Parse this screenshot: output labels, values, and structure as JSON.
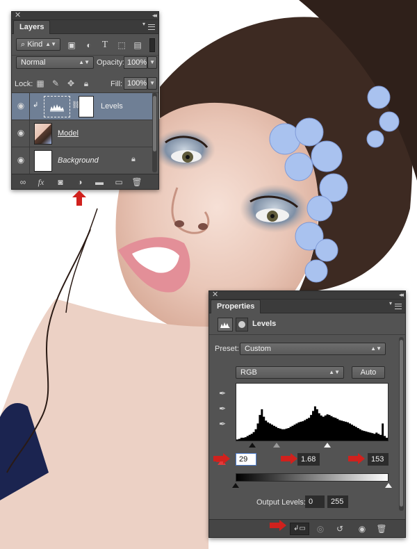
{
  "layers_panel": {
    "tab": "Layers",
    "filter_kind": "Kind",
    "blend_mode": "Normal",
    "opacity_label": "Opacity:",
    "opacity_value": "100%",
    "lock_label": "Lock:",
    "fill_label": "Fill:",
    "fill_value": "100%",
    "layers": [
      {
        "name": "Levels",
        "type": "adjustment",
        "active": true
      },
      {
        "name": "Model",
        "type": "image",
        "active": false
      },
      {
        "name": "Background",
        "type": "background",
        "active": false,
        "locked": true
      }
    ],
    "bottom_icons": [
      "link-icon",
      "fx-icon",
      "mask-icon",
      "adjustment-icon",
      "folder-icon",
      "new-layer-icon",
      "trash-icon"
    ]
  },
  "properties_panel": {
    "tab": "Properties",
    "adjustment_name": "Levels",
    "preset_label": "Preset:",
    "preset_value": "Custom",
    "channel_value": "RGB",
    "auto_label": "Auto",
    "input_black": "29",
    "input_gamma": "1.68",
    "input_white": "153",
    "output_label": "Output Levels:",
    "output_black": "0",
    "output_white": "255",
    "histogram_peaks": [
      0.02,
      0.03,
      0.05,
      0.05,
      0.06,
      0.08,
      0.1,
      0.12,
      0.15,
      0.2,
      0.3,
      0.45,
      0.55,
      0.42,
      0.35,
      0.32,
      0.3,
      0.28,
      0.26,
      0.24,
      0.22,
      0.21,
      0.2,
      0.2,
      0.21,
      0.22,
      0.24,
      0.26,
      0.28,
      0.3,
      0.32,
      0.33,
      0.34,
      0.36,
      0.38,
      0.4,
      0.45,
      0.52,
      0.6,
      0.55,
      0.48,
      0.44,
      0.42,
      0.44,
      0.46,
      0.45,
      0.43,
      0.41,
      0.4,
      0.38,
      0.36,
      0.35,
      0.34,
      0.33,
      0.32,
      0.3,
      0.28,
      0.26,
      0.24,
      0.22,
      0.2,
      0.18,
      0.17,
      0.16,
      0.15,
      0.14,
      0.13,
      0.12,
      0.14,
      0.12,
      0.1,
      0.3,
      0.08,
      0.05
    ],
    "bottom_icons": [
      "clip-to-layer-icon",
      "view-previous-icon",
      "reset-icon",
      "visibility-icon",
      "trash-icon"
    ]
  },
  "colors": {
    "panel_bg": "#535353",
    "panel_dark": "#3b3b3b",
    "active_layer": "#6f7f95",
    "annotation_red": "#d0211d"
  }
}
